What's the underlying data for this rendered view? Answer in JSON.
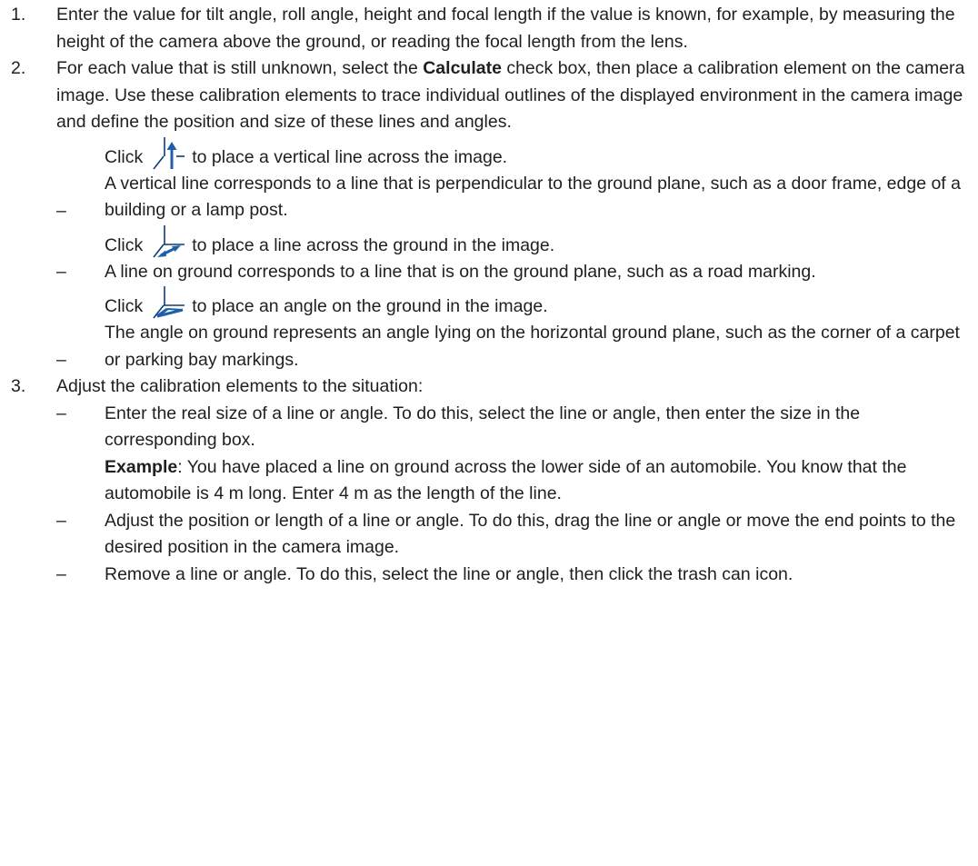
{
  "steps": [
    {
      "number": "1.",
      "text": "Enter the value for tilt angle, roll angle, height and focal length if the value is known, for example, by measuring the height of the camera above the ground, or reading the focal length from the lens."
    },
    {
      "number": "2.",
      "text_before": "For each value that is still unknown, select the ",
      "bold": "Calculate",
      "text_after": " check box, then place a calibration element on the camera image. Use these calibration elements to trace individual outlines of the displayed environment in the camera image and define the position and size of these lines and angles.",
      "items": [
        {
          "dash": "–",
          "click": "Click",
          "icon": "vertical-line-icon",
          "action": "to place a vertical line across the image.",
          "desc": "A vertical line corresponds to a line that is perpendicular to the ground plane, such as a door frame, edge of a building or a lamp post."
        },
        {
          "dash": "–",
          "click": "Click",
          "icon": "line-on-ground-icon",
          "action": "to place a line across the ground in the image.",
          "desc": "A line on ground corresponds to a line that is on the ground plane, such as a road marking."
        },
        {
          "dash": "–",
          "click": "Click",
          "icon": "angle-on-ground-icon",
          "action": "to place an angle on the ground in the image.",
          "desc": "The angle on ground represents an angle lying on the horizontal ground plane, such as the corner of a carpet or parking bay markings."
        }
      ]
    },
    {
      "number": "3.",
      "text": "Adjust the calibration elements to the situation:",
      "items": [
        {
          "dash": "–",
          "text": "Enter the real size of a line or angle. To do this, select the line or angle, then enter the size in the corresponding box.",
          "example_label": "Example",
          "example_text": ": You have placed a line on ground across the lower side of an automobile. You know that the automobile is 4 m long. Enter 4 m as the length of the line."
        },
        {
          "dash": "–",
          "text": "Adjust the position or length of a line or angle. To do this, drag the line or angle or move the end points to the desired position in the camera image."
        },
        {
          "dash": "–",
          "text": "Remove a line or angle. To do this, select the line or angle, then click the trash can icon."
        }
      ]
    }
  ],
  "colors": {
    "text": "#1f1f1f",
    "icon_blue": "#1f5fa8",
    "icon_dark": "#0f3d73"
  }
}
